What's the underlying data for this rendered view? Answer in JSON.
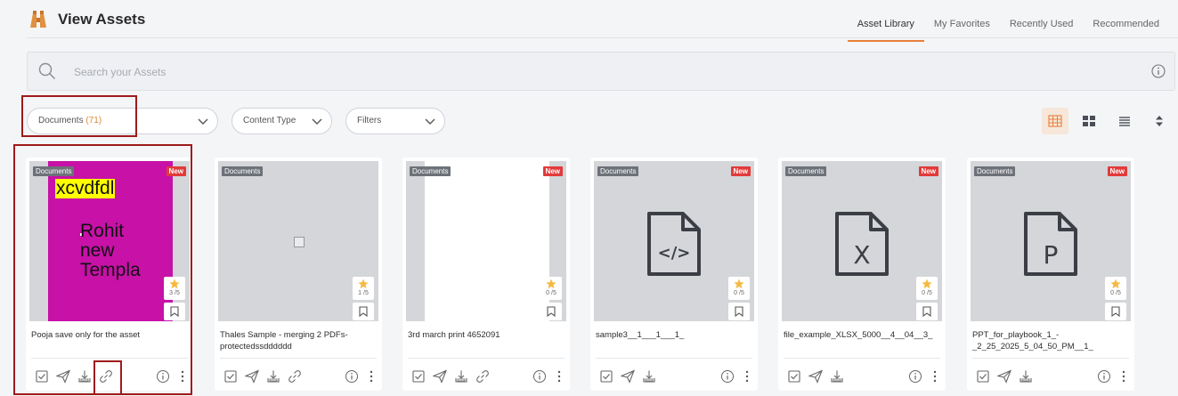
{
  "header": {
    "title": "View Assets",
    "tabs": [
      {
        "label": "Asset Library",
        "active": true
      },
      {
        "label": "My Favorites",
        "active": false
      },
      {
        "label": "Recently Used",
        "active": false
      },
      {
        "label": "Recommended",
        "active": false
      }
    ]
  },
  "search": {
    "placeholder": "Search your Assets",
    "value": ""
  },
  "filters": {
    "documents_label": "Documents",
    "documents_count": "(71)",
    "content_type_label": "Content Type",
    "filters_label": "Filters"
  },
  "view_modes": [
    "grid-small-icon",
    "grid-large-icon",
    "list-icon",
    "sort-icon"
  ],
  "colors": {
    "accent": "#e8803a",
    "new_badge": "#e23a3a",
    "doc_badge": "#6d7178",
    "star": "#f5b942",
    "highlight_box": "#9e1b1b",
    "magenta_preview": "#c711a7"
  },
  "cards": [
    {
      "badge": "Documents",
      "new_label": "New",
      "rating": "3 /5",
      "title": "Pooja save only for the asset",
      "preview": {
        "highlight": "xcvdfdl",
        "lines": [
          "Rohit",
          "new",
          "Templa"
        ]
      },
      "actions": [
        "checkbox-icon",
        "send-icon",
        "download-icon",
        "link-icon"
      ]
    },
    {
      "badge": "Documents",
      "new_label": "",
      "rating": "1 /5",
      "title": "Thales Sample - merging 2 PDFs- protectedssdddddd",
      "actions": [
        "checkbox-icon",
        "send-icon",
        "download-icon",
        "link-icon"
      ]
    },
    {
      "badge": "Documents",
      "new_label": "New",
      "rating": "0 /5",
      "title": "3rd march print 4652091",
      "actions": [
        "checkbox-icon",
        "send-icon",
        "download-icon",
        "link-icon"
      ]
    },
    {
      "badge": "Documents",
      "new_label": "New",
      "rating": "0 /5",
      "title": "sample3__1___1___1_",
      "file_glyph": "</>",
      "actions": [
        "checkbox-icon",
        "send-icon",
        "download-icon"
      ]
    },
    {
      "badge": "Documents",
      "new_label": "New",
      "rating": "0 /5",
      "title": "file_example_XLSX_5000__4__04__3_",
      "file_glyph": "X",
      "actions": [
        "checkbox-icon",
        "send-icon",
        "download-icon"
      ]
    },
    {
      "badge": "Documents",
      "new_label": "New",
      "rating": "0 /5",
      "title": "PPT_for_playbook_1_-_2_25_2025_5_04_50_PM__1_",
      "file_glyph": "P",
      "actions": [
        "checkbox-icon",
        "send-icon",
        "download-icon"
      ]
    }
  ]
}
